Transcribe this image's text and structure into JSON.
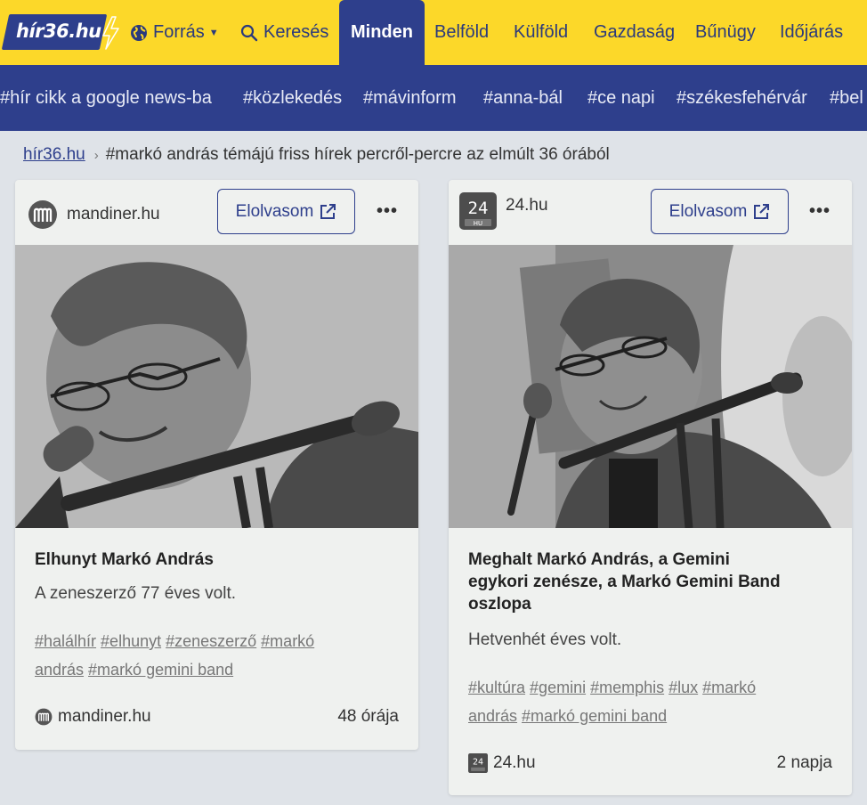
{
  "header": {
    "logo_text": "hír36.hu",
    "forras_label": "Forrás",
    "kereses_label": "Keresés",
    "active_tab": "Minden",
    "categories": [
      "Belföld",
      "Külföld",
      "Gazdaság",
      "Bűnügy",
      "Időjárás"
    ]
  },
  "tagbar": [
    "#hír cikk a google news-ba",
    "#közlekedés",
    "#mávinform",
    "#anna-bál",
    "#ce napi",
    "#székesfehérvár",
    "#bel"
  ],
  "breadcrumb": {
    "home": "hír36.hu",
    "current": "#markó andrás témájú friss hírek percről-percre az elmúlt 36 órából"
  },
  "cards": [
    {
      "source": "mandiner.hu",
      "read_label": "Elolvasom",
      "more_label": "•••",
      "title_lines": [
        "Elhunyt Markó András"
      ],
      "lead": "A zeneszerző 77 éves volt.",
      "tags_line1": [
        "#halálhír",
        "#elhunyt",
        "#zeneszerző",
        "#markó"
      ],
      "tags_line2": [
        "andrás",
        "#markó gemini band"
      ],
      "time": "48 órája"
    },
    {
      "source": "24.hu",
      "read_label": "Elolvasom",
      "more_label": "•••",
      "title_lines": [
        "Meghalt Markó András, a Gemini",
        "egykori zenésze, a Markó Gemini Band",
        "oszlopa"
      ],
      "lead": "Hetvenhét éves volt.",
      "tags_line1": [
        "#kultúra",
        "#gemini",
        "#memphis",
        "#lux",
        "#markó"
      ],
      "tags_line2": [
        "andrás",
        "#markó gemini band"
      ],
      "time": "2 napja"
    }
  ],
  "colors": {
    "yellow": "#fcd829",
    "navy": "#2e3f8c",
    "page_bg": "#dfe3e8",
    "card_bg": "#eff1ef"
  }
}
